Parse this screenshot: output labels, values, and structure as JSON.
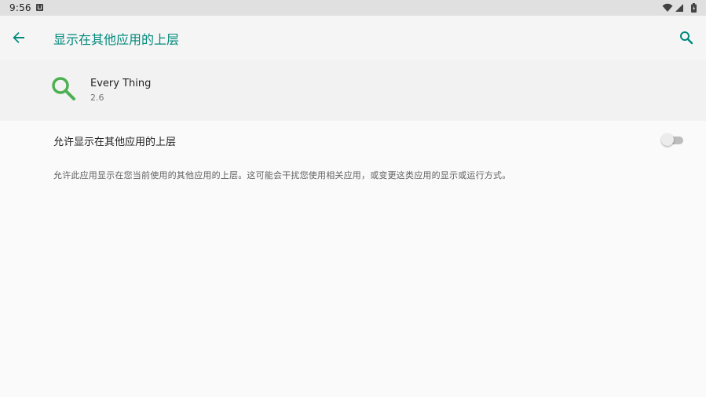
{
  "status_bar": {
    "time": "9:56",
    "notification_icon": "accessibility-notification-icon",
    "icons": [
      "wifi-icon",
      "signal-icon",
      "battery-icon"
    ]
  },
  "app_bar": {
    "back_icon": "arrow-back-icon",
    "title": "显示在其他应用的上层",
    "search_icon": "search-icon",
    "accent_color": "#00897b"
  },
  "app_info": {
    "icon": "magnifier-app-icon",
    "icon_color": "#4caf50",
    "name": "Every Thing",
    "version": "2.6"
  },
  "permission": {
    "label": "允许显示在其他应用的上层",
    "toggle_state": "off",
    "description": "允许此应用显示在您当前使用的其他应用的上层。这可能会干扰您使用相关应用，或变更这类应用的显示或运行方式。"
  }
}
